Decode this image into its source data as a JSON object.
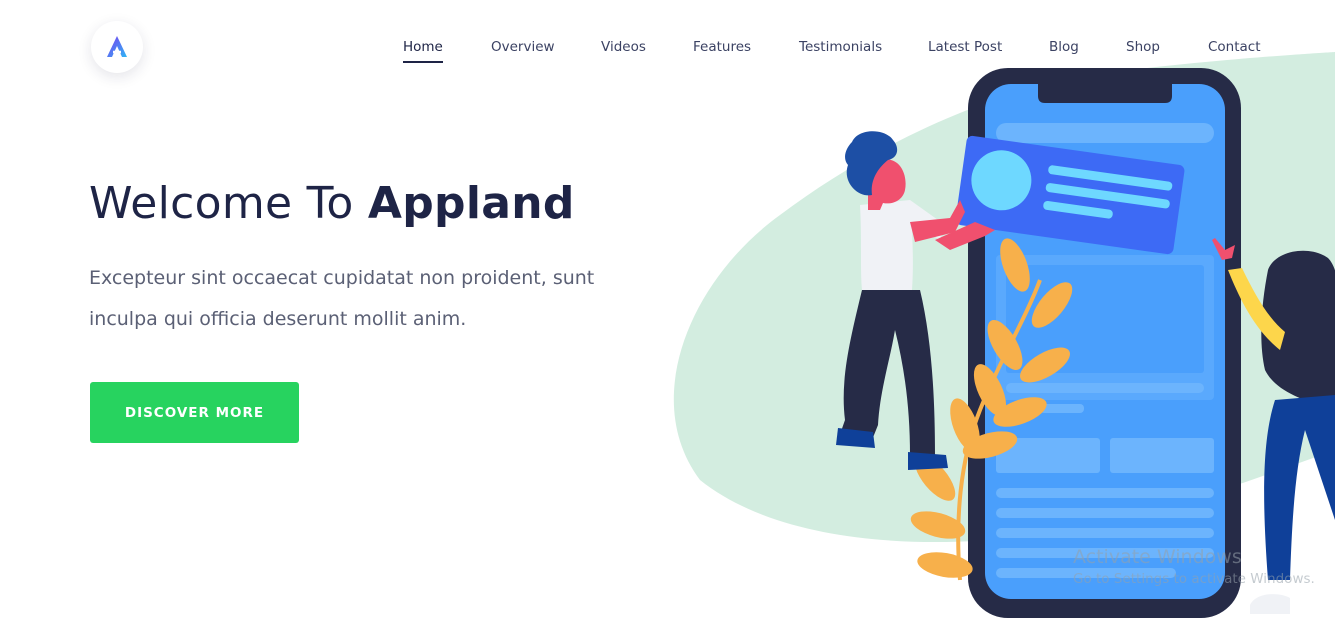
{
  "brand": {
    "logo_letter": "A",
    "logo_icon": "appland-logo-icon"
  },
  "nav": {
    "items": [
      {
        "label": "Home",
        "active": true
      },
      {
        "label": "Overview"
      },
      {
        "label": "Videos"
      },
      {
        "label": "Features"
      },
      {
        "label": "Testimonials"
      },
      {
        "label": "Latest Post"
      },
      {
        "label": "Blog"
      },
      {
        "label": "Shop"
      },
      {
        "label": "Contact"
      }
    ]
  },
  "hero": {
    "title_regular": "Welcome To",
    "title_bold": "Appland",
    "text": "Excepteur sint occaecat cupidatat non proident, sunt inculpa qui officia deserunt mollit anim.",
    "cta_label": "DISCOVER MORE"
  },
  "illustration": {
    "icon": "phone-with-people-illustration",
    "colors": {
      "blob": "#d3ede0",
      "phone_frame": "#262b47",
      "screen": "#4a9ffc",
      "card": "#3d6af5",
      "plant": "#f7b04b",
      "accent_pink": "#f0506e",
      "cta_green": "#27d35f"
    }
  },
  "watermark": {
    "title": "Activate Windows",
    "subtitle": "Go to Settings to activate Windows."
  }
}
